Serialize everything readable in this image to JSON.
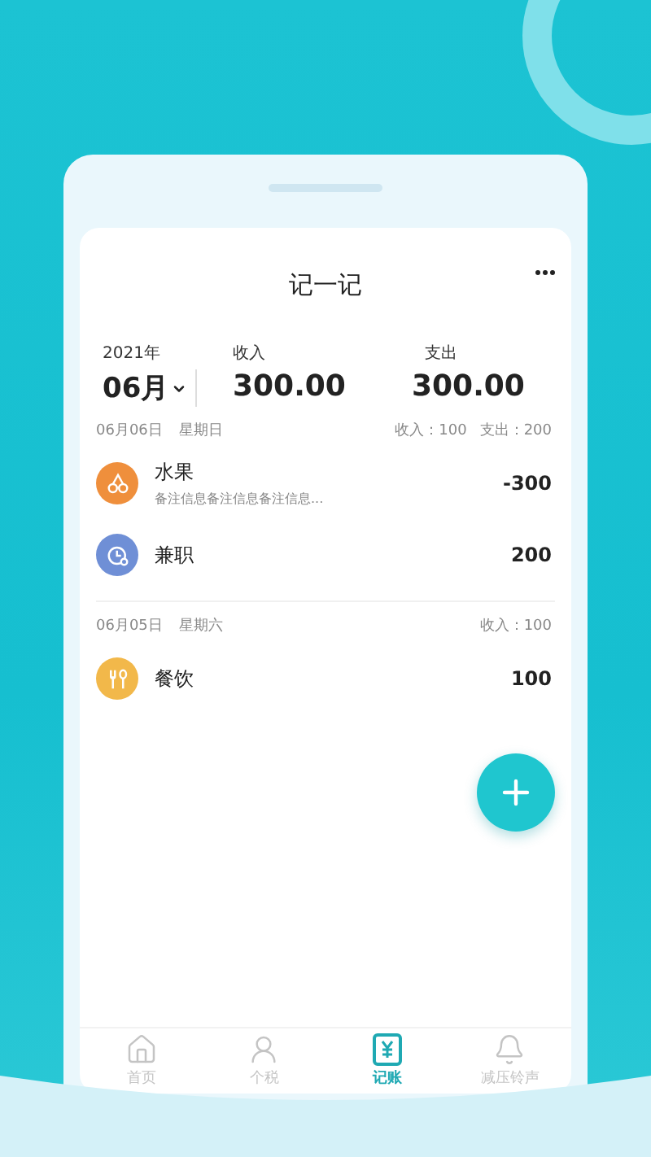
{
  "header": {
    "title": "记一记"
  },
  "summary": {
    "year": "2021年",
    "month": "06月",
    "income_label": "收入",
    "income": "300.00",
    "expense_label": "支出",
    "expense": "300.00"
  },
  "days": [
    {
      "date": "06月06日",
      "weekday": "星期日",
      "totals": [
        "收入：100",
        "支出：200"
      ],
      "entries": [
        {
          "kind": "fruit",
          "color": "#ef8f3c",
          "category": "水果",
          "note": "备注信息备注信息备注信息...",
          "amount": "-300"
        },
        {
          "kind": "job",
          "color": "#6f8fd6",
          "category": "兼职",
          "amount": "200"
        }
      ]
    },
    {
      "date": "06月05日",
      "weekday": "星期六",
      "totals": [
        "收入：100"
      ],
      "entries": [
        {
          "kind": "food",
          "color": "#f2b84a",
          "category": "餐饮",
          "amount": "100"
        }
      ]
    }
  ],
  "nav": [
    {
      "kind": "home",
      "label": "首页",
      "selected": false
    },
    {
      "kind": "tax",
      "label": "个税",
      "selected": false
    },
    {
      "kind": "ledger",
      "label": "记账",
      "selected": true
    },
    {
      "kind": "ringtone",
      "label": "减压铃声",
      "selected": false
    }
  ]
}
